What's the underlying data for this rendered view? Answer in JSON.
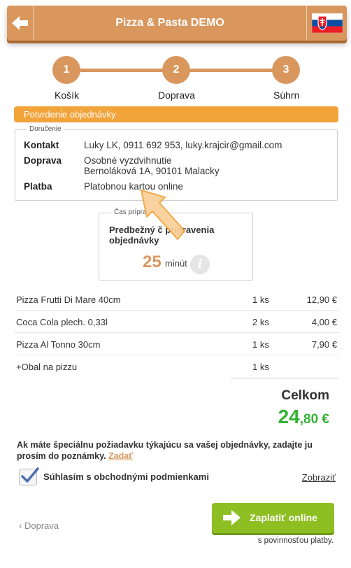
{
  "header": {
    "title": "Pizza & Pasta DEMO",
    "back_icon": "back-arrow-icon",
    "flag_icon": "slovakia-flag-icon"
  },
  "steps": [
    {
      "number": "1",
      "label": "Košík"
    },
    {
      "number": "2",
      "label": "Doprava"
    },
    {
      "number": "3",
      "label": "Súhrn"
    }
  ],
  "confirmation_bar": "Potvrdenie objednávky",
  "delivery": {
    "legend": "Doručenie",
    "rows": [
      {
        "label": "Kontakt",
        "value": "Luky LK, 0911 692 953, luky.krajcir@gmail.com"
      },
      {
        "label": "Doprava",
        "value": "Osobné vyzdvihnutie",
        "value2": "Bernoláková 1A, 90101 Malacky"
      },
      {
        "label": "Platba",
        "value": "Platobnou kartou online"
      }
    ]
  },
  "prep_time": {
    "legend": "Čas prípra",
    "title_line1": "Predbežný č",
    "title_line1_rest": "pripravenia",
    "title_line2": "objednávky",
    "value": "25",
    "unit": "minút",
    "info_icon": "info-icon"
  },
  "items": [
    {
      "name": "Pizza Frutti Di Mare 40cm",
      "qty": "1 ks",
      "price": "12,90 €"
    },
    {
      "name": "Coca Cola plech. 0,33l",
      "qty": "2 ks",
      "price": "4,00 €"
    },
    {
      "name": "Pizza Al Tonno 30cm",
      "qty": "1 ks",
      "price": "7,90 €"
    },
    {
      "name": "+Obal na pizzu",
      "qty": "1 ks",
      "price": ""
    }
  ],
  "total": {
    "label": "Celkom",
    "integer": "24",
    "decimal": ",80 €"
  },
  "note": {
    "text": "Ak máte špeciálnu požiadavku týkajúcu sa vašej objednávky, zadajte ju prosím do poznámky.",
    "link": "Zadať"
  },
  "terms": {
    "checked": true,
    "label": "Súhlasím s obchodnými podmienkami",
    "show_link": "Zobraziť"
  },
  "footer": {
    "back_label": "Doprava",
    "pay_label": "Zaplatiť online",
    "pay_note": "s povinnosťou platby."
  },
  "colors": {
    "accent": "#d9975e",
    "bar": "#f2a33a",
    "total": "#32b332",
    "pay_button": "#8dbf22"
  }
}
